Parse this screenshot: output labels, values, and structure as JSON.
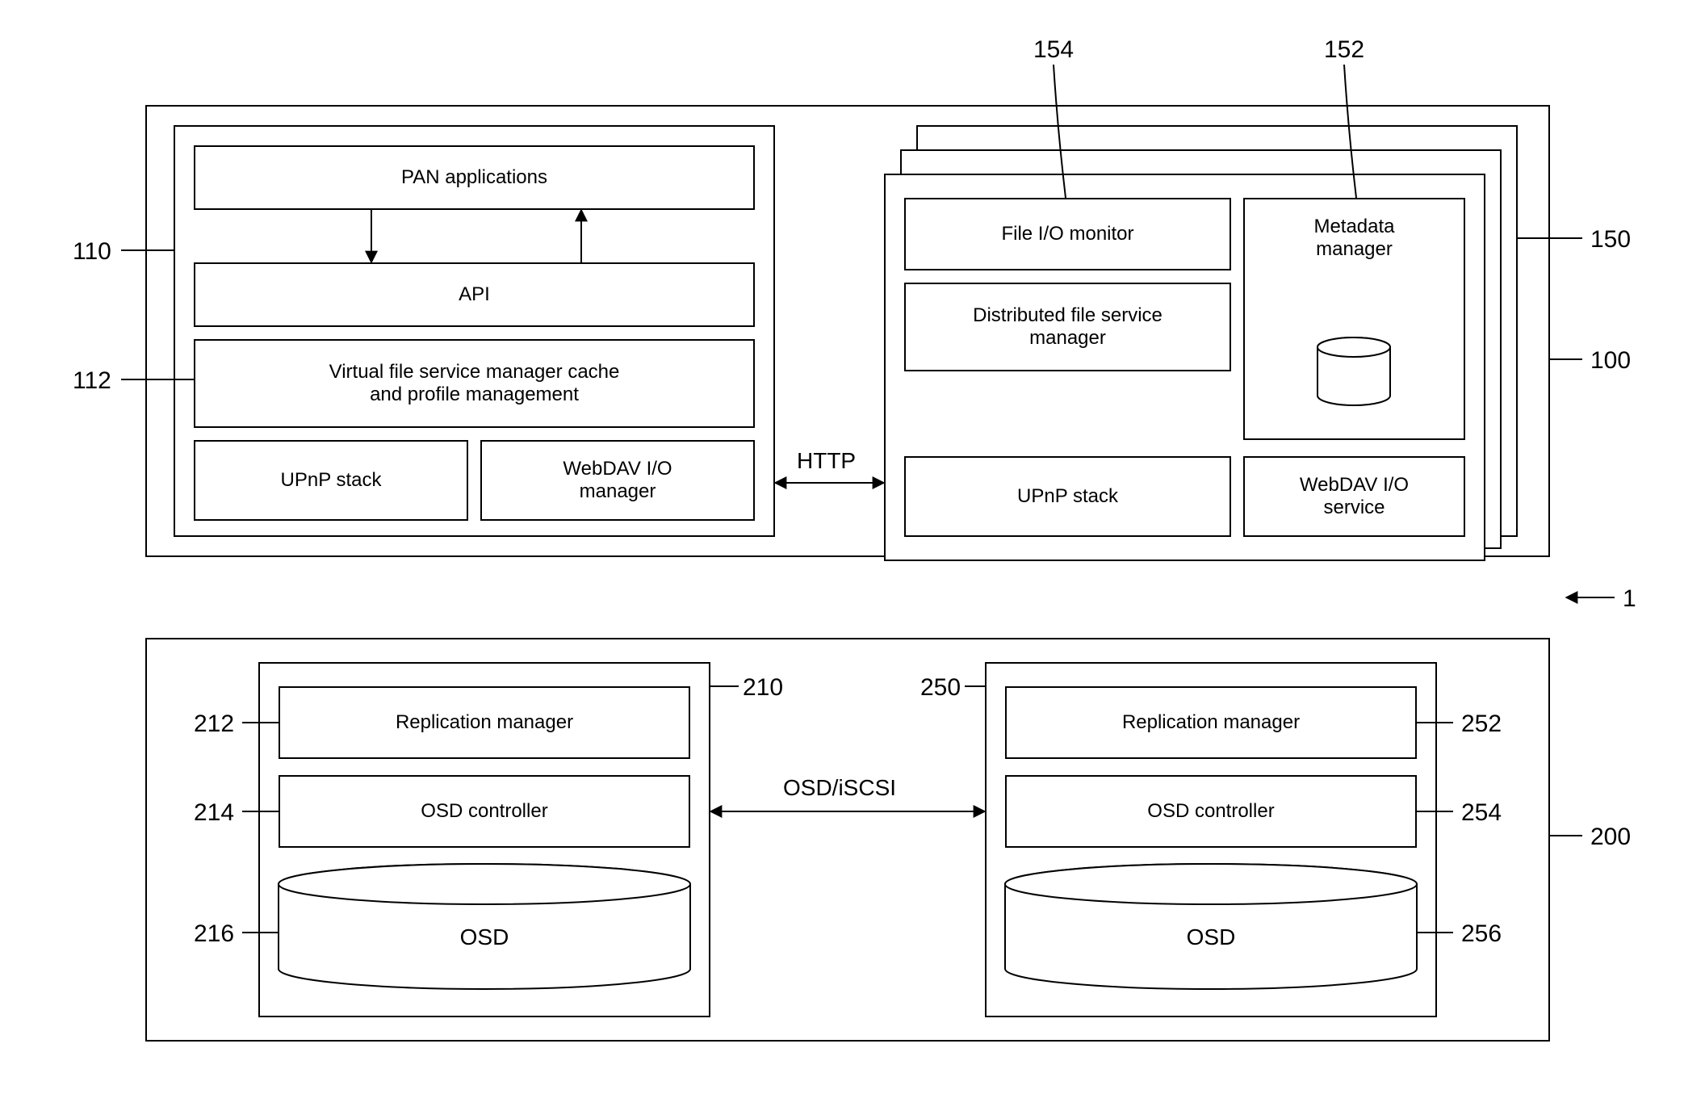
{
  "refs": {
    "r1": "1",
    "r100": "100",
    "r110": "110",
    "r112": "112",
    "r150": "150",
    "r152": "152",
    "r154": "154",
    "r200": "200",
    "r210": "210",
    "r212": "212",
    "r214": "214",
    "r216": "216",
    "r250": "250",
    "r252": "252",
    "r254": "254",
    "r256": "256"
  },
  "top": {
    "left": {
      "pan": "PAN applications",
      "api": "API",
      "vfs": "Virtual file service manager cache\nand profile management",
      "upnp": "UPnP stack",
      "webdav": "WebDAV I/O\nmanager"
    },
    "right": {
      "fio": "File I/O monitor",
      "dfs": "Distributed file service\nmanager",
      "upnp": "UPnP stack",
      "meta": "Metadata\nmanager",
      "webdav": "WebDAV I/O\nservice"
    },
    "link": "HTTP"
  },
  "bottom": {
    "link": "OSD/iSCSI",
    "left": {
      "rep": "Replication manager",
      "ctrl": "OSD controller",
      "osd": "OSD"
    },
    "right": {
      "rep": "Replication manager",
      "ctrl": "OSD controller",
      "osd": "OSD"
    }
  }
}
